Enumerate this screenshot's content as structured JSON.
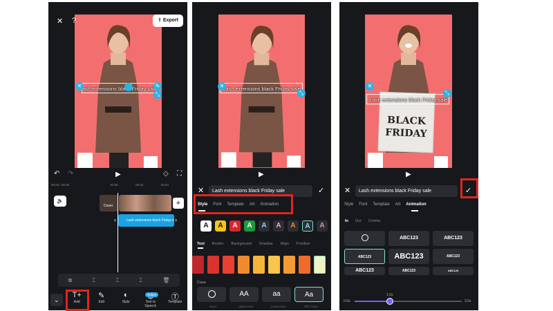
{
  "panel1": {
    "export_label": "Export",
    "overlay_text": "Lash extensions black Friday sale",
    "timecodes": [
      "00:00 / 00:00",
      "00:00",
      "00:02",
      "00:04"
    ],
    "cover_label": "Cover",
    "text_track_label": "Lash extensions black Friday s",
    "tools": [
      {
        "label": "Add",
        "icon": "add-text-icon"
      },
      {
        "label": "Edit",
        "icon": "pencil-icon"
      },
      {
        "label": "Style",
        "icon": "palette-icon"
      },
      {
        "label": "Text to Speech",
        "icon": "text-to-speech-icon"
      },
      {
        "label": "Template",
        "icon": "template-icon"
      }
    ],
    "free_badge": "Online"
  },
  "panel2": {
    "overlay_text": "Lash extensions black Friday sale",
    "input_value": "Lash extensions black Friday sale",
    "tabs": [
      "Style",
      "Font",
      "Template",
      "Art",
      "Animation"
    ],
    "active_tab": "Style",
    "subtabs": [
      "Text",
      "Border",
      "Background",
      "Shadow",
      "Align",
      "Position"
    ],
    "active_subtab": "Text",
    "case_label": "Case",
    "case_options": [
      {
        "glyph": "⃠",
        "name": "None"
      },
      {
        "glyph": "AA",
        "name": "Uppercase"
      },
      {
        "glyph": "aa",
        "name": "Lowercase"
      },
      {
        "glyph": "Aa",
        "name": "Title Case"
      }
    ],
    "swatches": [
      "#c0262c",
      "#d9352c",
      "#e84033",
      "#f08a2e",
      "#f5b53a",
      "#f7c64a",
      "#f39a33",
      "#ef6b2c",
      "#f2f2c2"
    ]
  },
  "panel3": {
    "overlay_text": "Lash extensions black Friday sale",
    "board_text": [
      "BLACK",
      "FRIDAY"
    ],
    "input_value": "Lash extensions black Friday sale",
    "tabs": [
      "Style",
      "Font",
      "Template",
      "Art",
      "Animation"
    ],
    "active_tab": "Animation",
    "subtabs": [
      "In",
      "Out",
      "Combo"
    ],
    "active_subtab": "In",
    "anim_tiles": [
      "⃠",
      "ABC123",
      "ABC123",
      "ABC123",
      "ABC123",
      "ABC123",
      "ABC123",
      "ABC123",
      "ABC123"
    ],
    "slider_start": "0.0s",
    "slider_value": "1.0s",
    "slider_end": "3.0s",
    "slider_fraction": 0.33
  },
  "colors": {
    "highlight": "#e0261e",
    "accent": "#2ab3e8",
    "selection": "#7de2d1"
  }
}
